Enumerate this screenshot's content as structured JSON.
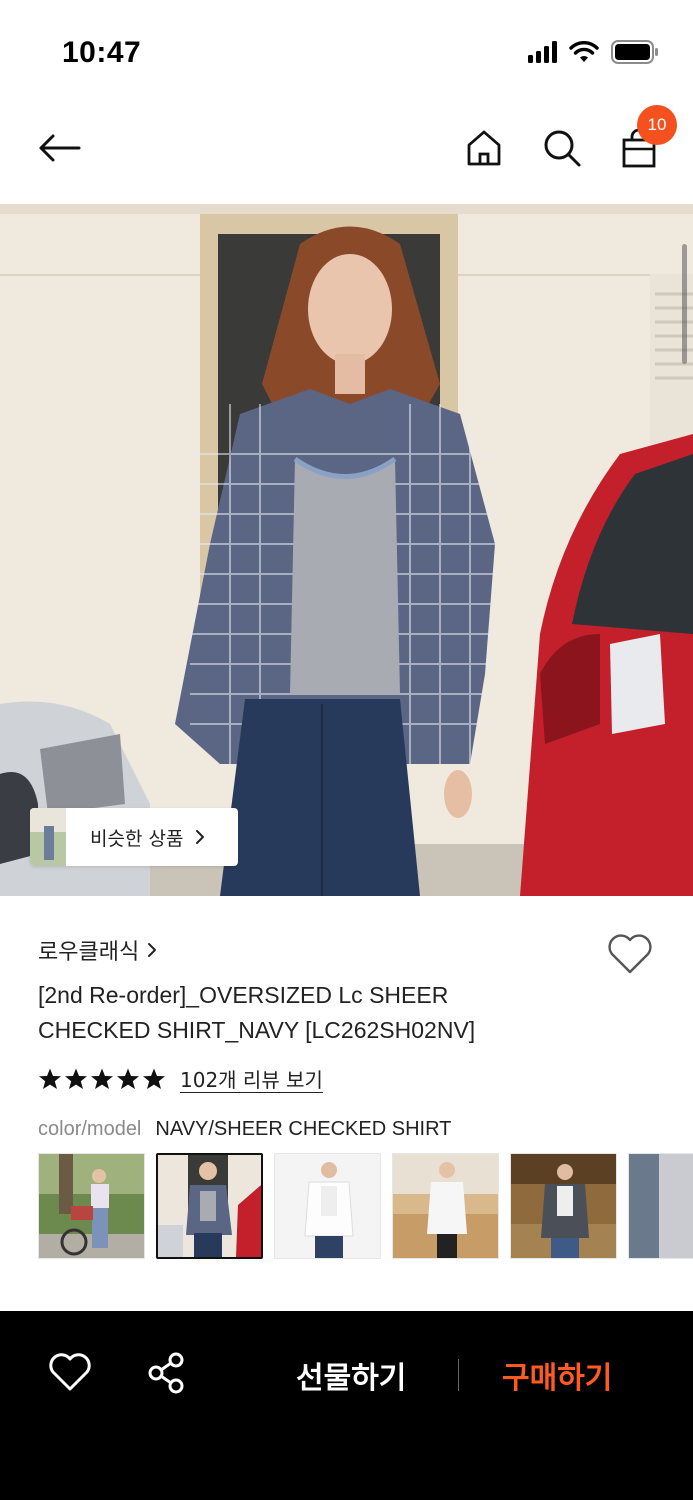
{
  "status_bar": {
    "time": "10:47"
  },
  "header": {
    "back_icon": "arrow-left-icon",
    "home_icon": "home-icon",
    "search_icon": "search-icon",
    "cart_icon": "shopping-bag-icon",
    "cart_count": "10"
  },
  "hero": {
    "similar_button_label": "비슷한 상품"
  },
  "product": {
    "brand": "로우클래식",
    "title_line1": "[2nd Re-order]_OVERSIZED Lc SHEER",
    "title_line2": "CHECKED SHIRT_NAVY [LC262SH02NV]",
    "rating_stars": 5,
    "review_link": "102개 리뷰 보기",
    "option_label": "color/model",
    "option_value": "NAVY/SHEER CHECKED SHIRT",
    "variants": [
      {
        "name": "variant-1"
      },
      {
        "name": "variant-2",
        "selected": true
      },
      {
        "name": "variant-3"
      },
      {
        "name": "variant-4"
      },
      {
        "name": "variant-5"
      },
      {
        "name": "variant-6"
      }
    ]
  },
  "bottom_bar": {
    "gift_label": "선물하기",
    "buy_label": "구매하기"
  },
  "colors": {
    "accent": "#ff5a1f",
    "badge": "#f4511e",
    "bottom_bar_bg": "#000000"
  }
}
